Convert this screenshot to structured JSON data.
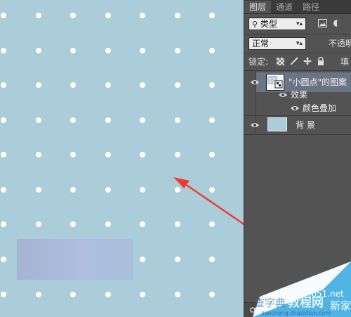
{
  "panel": {
    "tabs": [
      {
        "label": "图层",
        "active": true
      },
      {
        "label": "通道",
        "active": false
      },
      {
        "label": "路径",
        "active": false
      }
    ],
    "filter": {
      "value": "类型"
    },
    "blend_mode": {
      "value": "正常"
    },
    "opacity_label": "不透明",
    "lock_label": "锁定:",
    "fill_label": "填",
    "layers": [
      {
        "name": "\"小圆点\"的图案",
        "selected": true
      },
      {
        "name": "效果",
        "indent": 1
      },
      {
        "name": "颜色叠加",
        "indent": 2
      },
      {
        "name": "背 景"
      }
    ]
  },
  "watermark": {
    "site": "jb51.net",
    "big": "教程网",
    "prefix": "查字典",
    "suffix": "新家",
    "url": "jiaocheng.chazidian.com"
  },
  "colors": {
    "canvas": "#aacdd9",
    "dot": "#ffffff",
    "arrow": "#ef3a34",
    "swatch": "#aebde0",
    "panel": "#535353",
    "selected_layer": "#6a7583"
  },
  "icons": [
    "eye-icon",
    "search-icon",
    "image-filter-icon",
    "circle-filter-icon",
    "lock-transparency-icon",
    "lock-paint-icon",
    "lock-move-icon",
    "lock-all-icon",
    "chain-link-icon"
  ]
}
